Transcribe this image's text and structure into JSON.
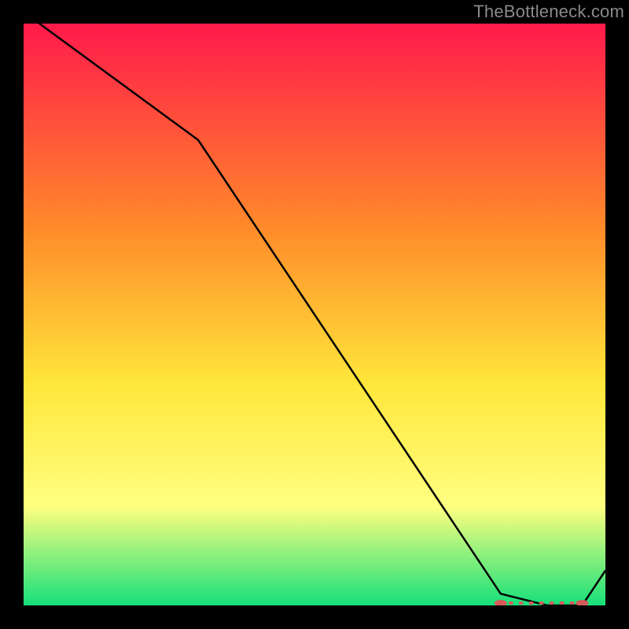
{
  "attribution": "TheBottleneck.com",
  "colors": {
    "gradient_top": "#ff1a4b",
    "gradient_mid_upper": "#ff8a2a",
    "gradient_mid": "#ffe73a",
    "gradient_lower": "#ffff80",
    "gradient_bottom": "#16e07a",
    "curve": "#000000",
    "markers": "#d65a5a",
    "frame_bg": "#000000"
  },
  "chart_data": {
    "type": "line",
    "title": "",
    "xlabel": "",
    "ylabel": "",
    "xlim": [
      0,
      100
    ],
    "ylim": [
      0,
      100
    ],
    "x": [
      0,
      30,
      82,
      90,
      96,
      100
    ],
    "values": [
      102,
      80,
      2,
      0,
      0,
      6
    ],
    "optimal_band": {
      "start_x": 82,
      "end_x": 96,
      "y": 0
    }
  }
}
